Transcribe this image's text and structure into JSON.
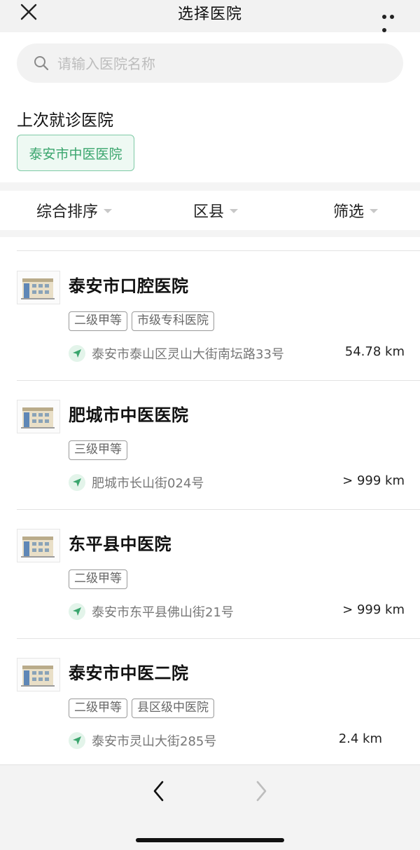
{
  "header": {
    "title": "选择医院"
  },
  "search": {
    "placeholder": "请输入医院名称"
  },
  "recent": {
    "title": "上次就诊医院",
    "hospital": "泰安市中医医院"
  },
  "filters": [
    {
      "label": "综合排序"
    },
    {
      "label": "区县"
    },
    {
      "label": "筛选"
    }
  ],
  "hospitals": [
    {
      "name": "泰安市口腔医院",
      "tags": [
        "二级甲等",
        "市级专科医院"
      ],
      "address": "泰安市泰山区灵山大街南坛路33号",
      "distance": "54.78 km"
    },
    {
      "name": "肥城市中医医院",
      "tags": [
        "三级甲等"
      ],
      "address": "肥城市长山街024号",
      "distance": "> 999 km"
    },
    {
      "name": "东平县中医院",
      "tags": [
        "二级甲等"
      ],
      "address": "泰安市东平县佛山街21号",
      "distance": "> 999 km"
    },
    {
      "name": "泰安市中医二院",
      "tags": [
        "二级甲等",
        "县区级中医院"
      ],
      "address": "泰安市灵山大街285号",
      "distance": "2.4 km"
    }
  ],
  "icons": {
    "close": "close-icon",
    "more": "more-icon",
    "search": "search-icon",
    "location": "location-arrow-icon",
    "back": "chevron-left-icon",
    "forward": "chevron-right-icon"
  },
  "colors": {
    "accent": "#3aa56d",
    "accent_border": "#7fcaa6",
    "accent_bg": "#eef9f3"
  }
}
